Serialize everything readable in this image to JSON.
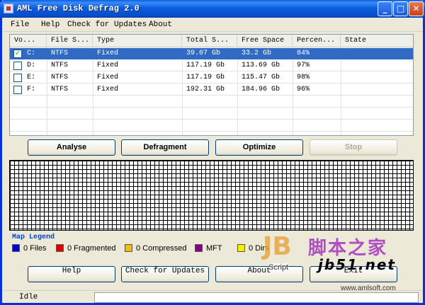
{
  "window": {
    "title": "AML Free Disk Defrag 2.0"
  },
  "menu": [
    "File",
    "Help",
    "Check for Updates",
    "About"
  ],
  "table": {
    "columns": [
      "Vo...",
      "File S...",
      "Type",
      "Total S...",
      "Free Space",
      "Percen...",
      "State"
    ],
    "rows": [
      {
        "checked": true,
        "volume": "C:",
        "fs": "NTFS",
        "type": "Fixed",
        "total": "39.07 Gb",
        "free": "33.2 Gb",
        "percent": "84%",
        "state": "",
        "selected": true
      },
      {
        "checked": false,
        "volume": "D:",
        "fs": "NTFS",
        "type": "Fixed",
        "total": "117.19 Gb",
        "free": "113.69 Gb",
        "percent": "97%",
        "state": "",
        "selected": false
      },
      {
        "checked": false,
        "volume": "E:",
        "fs": "NTFS",
        "type": "Fixed",
        "total": "117.19 Gb",
        "free": "115.47 Gb",
        "percent": "98%",
        "state": "",
        "selected": false
      },
      {
        "checked": false,
        "volume": "F:",
        "fs": "NTFS",
        "type": "Fixed",
        "total": "192.31 Gb",
        "free": "184.96 Gb",
        "percent": "96%",
        "state": "",
        "selected": false
      }
    ]
  },
  "actions": {
    "analyse": "Analyse",
    "defragment": "Defragment",
    "optimize": "Optimize",
    "stop": "Stop"
  },
  "legend": {
    "title": "Map Legend",
    "items": [
      {
        "label": "0 Files",
        "color": "#0000cc"
      },
      {
        "label": "0 Fragmented",
        "color": "#dd0000"
      },
      {
        "label": "0 Compressed",
        "color": "#f0c000"
      },
      {
        "label": "MFT",
        "color": "#800080"
      },
      {
        "label": "0 Dirs",
        "color": "#f0f000"
      }
    ]
  },
  "bottom_buttons": {
    "help": "Help",
    "check_updates": "Check for Updates",
    "about": "About",
    "exit": "Exit"
  },
  "status": {
    "text": "Idle"
  },
  "watermark": {
    "logo": "JB",
    "script": "Script",
    "cn": "脚本之家",
    "site": "jb51.net",
    "url": "www.amlsoft.com"
  }
}
